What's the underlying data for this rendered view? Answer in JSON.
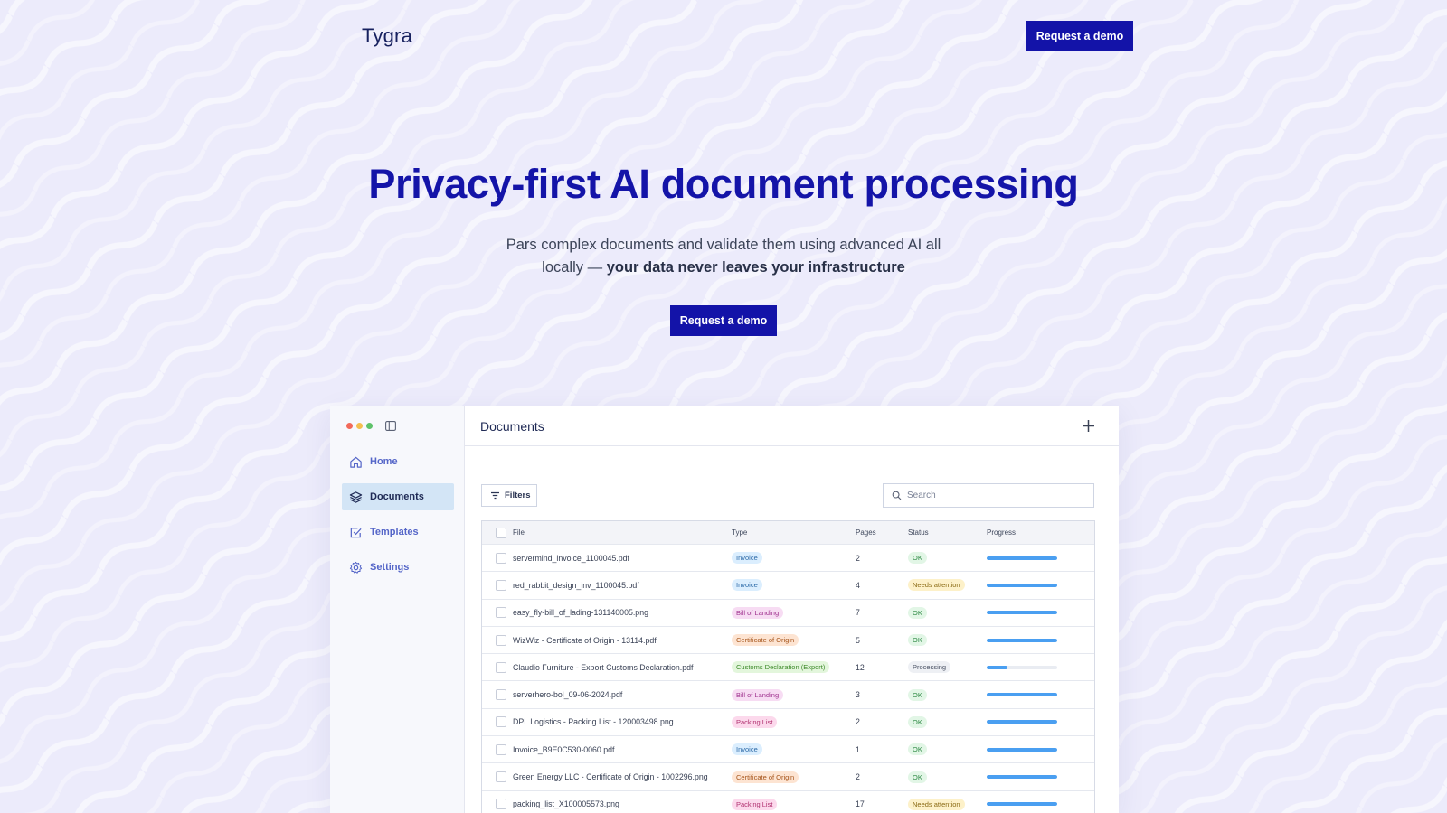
{
  "header": {
    "logo": "Tygra",
    "demo_button": "Request a demo"
  },
  "hero": {
    "title": "Privacy-first AI document processing",
    "subtitle_plain": "Pars complex documents and validate them using advanced AI all locally — ",
    "subtitle_bold": "your data never leaves your infrastructure",
    "demo_button": "Request a demo"
  },
  "colors": {
    "brand": "#1313a8",
    "accent_blue": "#4a9ff1",
    "window_red": "#f26a5a",
    "window_yellow": "#f4bf4f",
    "window_green": "#5ec26a"
  },
  "app": {
    "sidebar": {
      "items": [
        {
          "label": "Home",
          "icon": "home-icon",
          "active": false
        },
        {
          "label": "Documents",
          "icon": "layers-icon",
          "active": true
        },
        {
          "label": "Templates",
          "icon": "checkbox-icon",
          "active": false
        },
        {
          "label": "Settings",
          "icon": "gear-icon",
          "active": false
        }
      ]
    },
    "main": {
      "title": "Documents",
      "filters_label": "Filters",
      "search_placeholder": "Search",
      "columns": [
        "File",
        "Type",
        "Pages",
        "Status",
        "Progress"
      ],
      "rows": [
        {
          "file": "servermind_invoice_1100045.pdf",
          "type": "Invoice",
          "type_color": "#dbeefe",
          "type_text": "#2c6aa8",
          "pages": "2",
          "status": "OK",
          "status_color": "#e2f6e6",
          "status_text": "#2f8a45",
          "progress": 1.0
        },
        {
          "file": "red_rabbit_design_inv_1100045.pdf",
          "type": "Invoice",
          "type_color": "#dbeefe",
          "type_text": "#2c6aa8",
          "pages": "4",
          "status": "Needs attention",
          "status_color": "#fdf1c9",
          "status_text": "#8a6a14",
          "progress": 1.0
        },
        {
          "file": "easy_fly-bill_of_lading-131140005.png",
          "type": "Bill of Landing",
          "type_color": "#f7dcf3",
          "type_text": "#a0338f",
          "pages": "7",
          "status": "OK",
          "status_color": "#e2f6e6",
          "status_text": "#2f8a45",
          "progress": 1.0
        },
        {
          "file": " WizWiz - Certificate of Origin - 13114.pdf",
          "type": "Certificate of Origin",
          "type_color": "#fde4d2",
          "type_text": "#a6541a",
          "pages": "5",
          "status": "OK",
          "status_color": "#e2f6e6",
          "status_text": "#2f8a45",
          "progress": 1.0
        },
        {
          "file": "Claudio Furniture - Export Customs Declaration.pdf",
          "type": "Customs Declaration (Export)",
          "type_color": "#e3f6dc",
          "type_text": "#3d8a2a",
          "pages": "12",
          "status": "Processing",
          "status_color": "#eef0f4",
          "status_text": "#4a5264",
          "progress": 0.3
        },
        {
          "file": "serverhero-bol_09-06-2024.pdf",
          "type": "Bill of Landing",
          "type_color": "#f7dcf3",
          "type_text": "#a0338f",
          "pages": "3",
          "status": "OK",
          "status_color": "#e2f6e6",
          "status_text": "#2f8a45",
          "progress": 1.0
        },
        {
          "file": "DPL Logistics - Packing List - 120003498.png",
          "type": "Packing List",
          "type_color": "#fcd9ec",
          "type_text": "#b0306f",
          "pages": "2",
          "status": "OK",
          "status_color": "#e2f6e6",
          "status_text": "#2f8a45",
          "progress": 1.0
        },
        {
          "file": "Invoice_B9E0C530-0060.pdf",
          "type": "Invoice",
          "type_color": "#dbeefe",
          "type_text": "#2c6aa8",
          "pages": "1",
          "status": "OK",
          "status_color": "#e2f6e6",
          "status_text": "#2f8a45",
          "progress": 1.0
        },
        {
          "file": " Green Energy LLC - Certificate of Origin - 1002296.png",
          "type": "Certificate of Origin",
          "type_color": "#fde4d2",
          "type_text": "#a6541a",
          "pages": "2",
          "status": "OK",
          "status_color": "#e2f6e6",
          "status_text": "#2f8a45",
          "progress": 1.0
        },
        {
          "file": "packing_list_X100005573.png",
          "type": "Packing List",
          "type_color": "#fcd9ec",
          "type_text": "#b0306f",
          "pages": "17",
          "status": "Needs attention",
          "status_color": "#fdf1c9",
          "status_text": "#8a6a14",
          "progress": 1.0
        }
      ]
    }
  }
}
